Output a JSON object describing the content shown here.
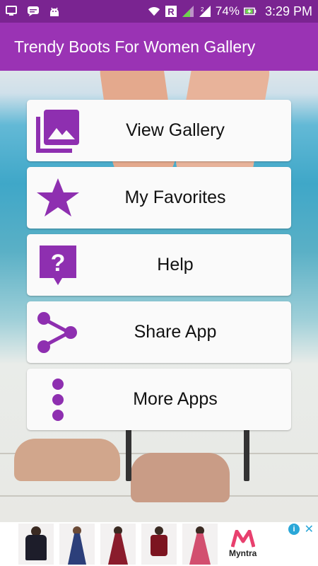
{
  "status_bar": {
    "battery": "74%",
    "time": "3:29 PM",
    "icons": [
      "screen-icon",
      "message-icon",
      "android-icon",
      "wifi-icon",
      "r-icon",
      "signal-icon",
      "signal-2-icon",
      "battery-icon"
    ]
  },
  "app_bar": {
    "title": "Trendy Boots For Women Gallery"
  },
  "menu": {
    "items": [
      {
        "label": "View Gallery",
        "icon": "gallery-icon"
      },
      {
        "label": "My Favorites",
        "icon": "star-icon"
      },
      {
        "label": "Help",
        "icon": "help-icon"
      },
      {
        "label": "Share App",
        "icon": "share-icon"
      },
      {
        "label": "More Apps",
        "icon": "more-vert-icon"
      }
    ]
  },
  "ad": {
    "brand": "Myntra",
    "info_icon": "ad-info-icon",
    "close_icon": "ad-close-icon"
  },
  "colors": {
    "status_bar": "#7a2491",
    "app_bar": "#9a33b4",
    "icon_purple": "#8e2fb0"
  }
}
